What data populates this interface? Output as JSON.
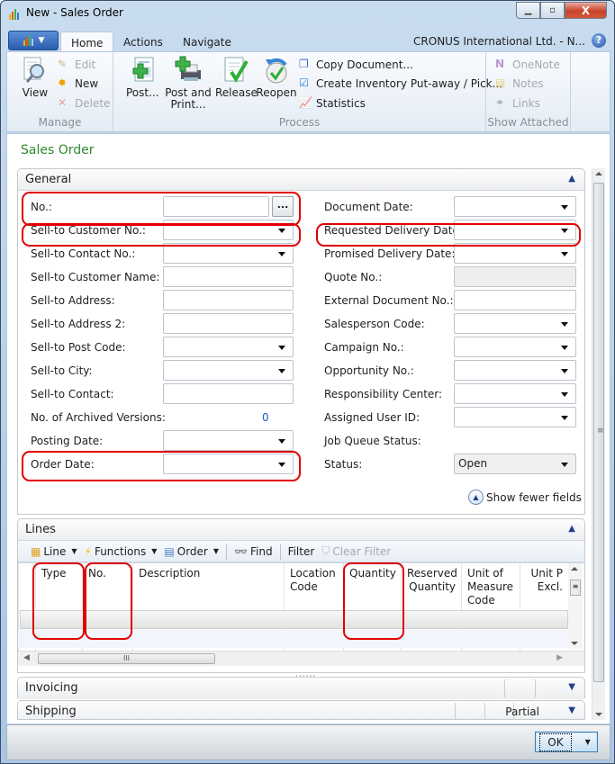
{
  "window": {
    "title": "New - Sales Order",
    "controls": {
      "minimize": "—",
      "maximize": "□",
      "close": "X"
    }
  },
  "ribbon": {
    "tabs": [
      {
        "label": "Home",
        "active": true
      },
      {
        "label": "Actions",
        "active": false
      },
      {
        "label": "Navigate",
        "active": false
      }
    ],
    "company": "CRONUS International Ltd. - N...",
    "help": "?",
    "groups": {
      "manage": {
        "label": "Manage",
        "view": "View",
        "edit": "Edit",
        "new": "New",
        "delete": "Delete"
      },
      "process": {
        "label": "Process",
        "post": "Post...",
        "post_print": [
          "Post and",
          "Print..."
        ],
        "release": "Release",
        "reopen": "Reopen",
        "copy_document": "Copy Document...",
        "create_inventory": "Create Inventory Put-away / Pick...",
        "statistics": "Statistics"
      },
      "show_attached": {
        "label": "Show Attached",
        "onenote": "OneNote",
        "notes": "Notes",
        "links": "Links"
      }
    }
  },
  "page": {
    "title": "Sales Order"
  },
  "general": {
    "header": "General",
    "left_fields": [
      {
        "label": "No.:",
        "value": "",
        "type": "lookup"
      },
      {
        "label": "Sell-to Customer No.:",
        "value": "",
        "type": "dropdown"
      },
      {
        "label": "Sell-to Contact No.:",
        "value": "",
        "type": "dropdown"
      },
      {
        "label": "Sell-to Customer Name:",
        "value": "",
        "type": "text"
      },
      {
        "label": "Sell-to Address:",
        "value": "",
        "type": "text"
      },
      {
        "label": "Sell-to Address 2:",
        "value": "",
        "type": "text"
      },
      {
        "label": "Sell-to Post Code:",
        "value": "",
        "type": "dropdown"
      },
      {
        "label": "Sell-to City:",
        "value": "",
        "type": "dropdown"
      },
      {
        "label": "Sell-to Contact:",
        "value": "",
        "type": "text"
      },
      {
        "label": "No. of Archived Versions:",
        "value": "0",
        "type": "readonly"
      },
      {
        "label": "Posting Date:",
        "value": "",
        "type": "dropdown"
      },
      {
        "label": "Order Date:",
        "value": "",
        "type": "dropdown"
      }
    ],
    "right_fields": [
      {
        "label": "Document Date:",
        "value": "",
        "type": "dropdown"
      },
      {
        "label": "Requested Delivery Date:",
        "value": "",
        "type": "dropdown"
      },
      {
        "label": "Promised Delivery Date:",
        "value": "",
        "type": "dropdown"
      },
      {
        "label": "Quote No.:",
        "value": "",
        "type": "disabled"
      },
      {
        "label": "External Document No.:",
        "value": "",
        "type": "text"
      },
      {
        "label": "Salesperson Code:",
        "value": "",
        "type": "dropdown"
      },
      {
        "label": "Campaign No.:",
        "value": "",
        "type": "dropdown"
      },
      {
        "label": "Opportunity No.:",
        "value": "",
        "type": "dropdown"
      },
      {
        "label": "Responsibility Center:",
        "value": "",
        "type": "dropdown"
      },
      {
        "label": "Assigned User ID:",
        "value": "",
        "type": "dropdown"
      },
      {
        "label": "Job Queue Status:",
        "value": "",
        "type": "none"
      },
      {
        "label": "Status:",
        "value": "Open",
        "type": "dropdown"
      }
    ],
    "show_fewer": "Show fewer fields",
    "lookup_button": "..."
  },
  "lines": {
    "header": "Lines",
    "toolbar": {
      "line": "Line",
      "functions": "Functions",
      "order": "Order",
      "find": "Find",
      "filter": "Filter",
      "clear_filter": "Clear Filter"
    },
    "columns": [
      {
        "label": "Type"
      },
      {
        "label": "No."
      },
      {
        "label": "Description"
      },
      {
        "label": "Location Code"
      },
      {
        "label": "Quantity"
      },
      {
        "label": "Reserved Quantity"
      },
      {
        "label": "Unit of Measure Code"
      },
      {
        "label": "Unit P Excl."
      }
    ],
    "hscroll_grip": "III"
  },
  "invoicing": {
    "header": "Invoicing"
  },
  "shipping": {
    "header": "Shipping",
    "value": "Partial"
  },
  "footer": {
    "ok": "OK"
  },
  "colors": {
    "page_title": "#2f8a2f",
    "highlight": "#e00000",
    "link_value": "#1f5fbf"
  }
}
